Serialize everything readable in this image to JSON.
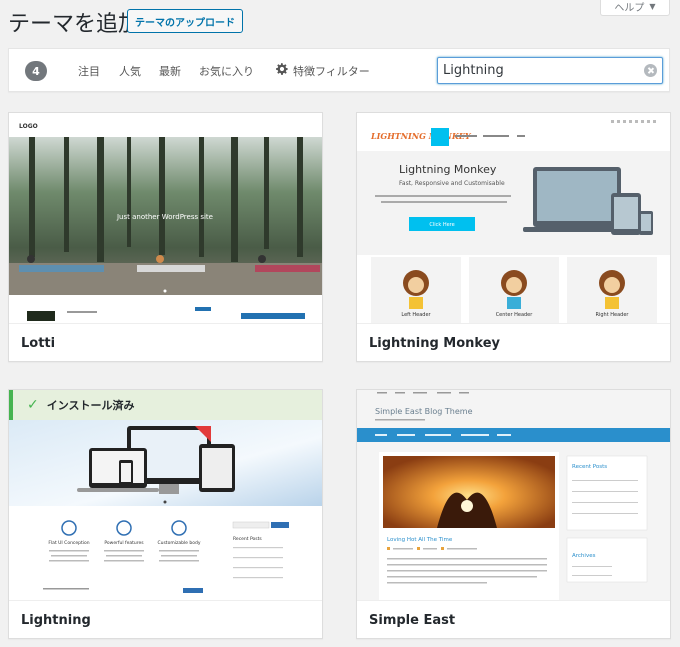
{
  "help_tab": {
    "label": "ヘルプ",
    "arrow": "▼"
  },
  "header": {
    "title": "テーマを追加",
    "upload_label": "テーマのアップロード"
  },
  "filter": {
    "count": "4",
    "links": [
      "注目",
      "人気",
      "最新",
      "お気に入り"
    ],
    "feature_filter_label": "特徴フィルター",
    "search_value": "Lightning"
  },
  "themes": [
    {
      "name": "Lotti",
      "preview": {
        "logo": "LOGO",
        "tagline": "Just another WordPress site"
      }
    },
    {
      "name": "Lightning Monkey",
      "preview": {
        "logo": "LIGHTNING MONKEY",
        "headline": "Lightning Monkey",
        "subheadline": "Fast, Responsive and Customisable",
        "cta": "Click Here",
        "panels": [
          "Left Header",
          "Center Header",
          "Right Header"
        ]
      }
    },
    {
      "name": "Lightning",
      "installed_label": "インストール済み",
      "preview": {
        "features": [
          "Flat UI Conception",
          "Powerful features",
          "Customizable body"
        ],
        "sidebar_heading": "Recent Posts"
      }
    },
    {
      "name": "Simple East",
      "preview": {
        "blog_title": "Simple East Blog Theme",
        "post_title": "Loving Hot All The Time",
        "sidebar_recent": "Recent Posts",
        "sidebar_archives": "Archives"
      }
    }
  ],
  "colors": {
    "accent": "#0073aa",
    "installed": "#46b450",
    "lightning_blue": "#00c0ef",
    "simpleeast_blue": "#2a8fcc"
  }
}
